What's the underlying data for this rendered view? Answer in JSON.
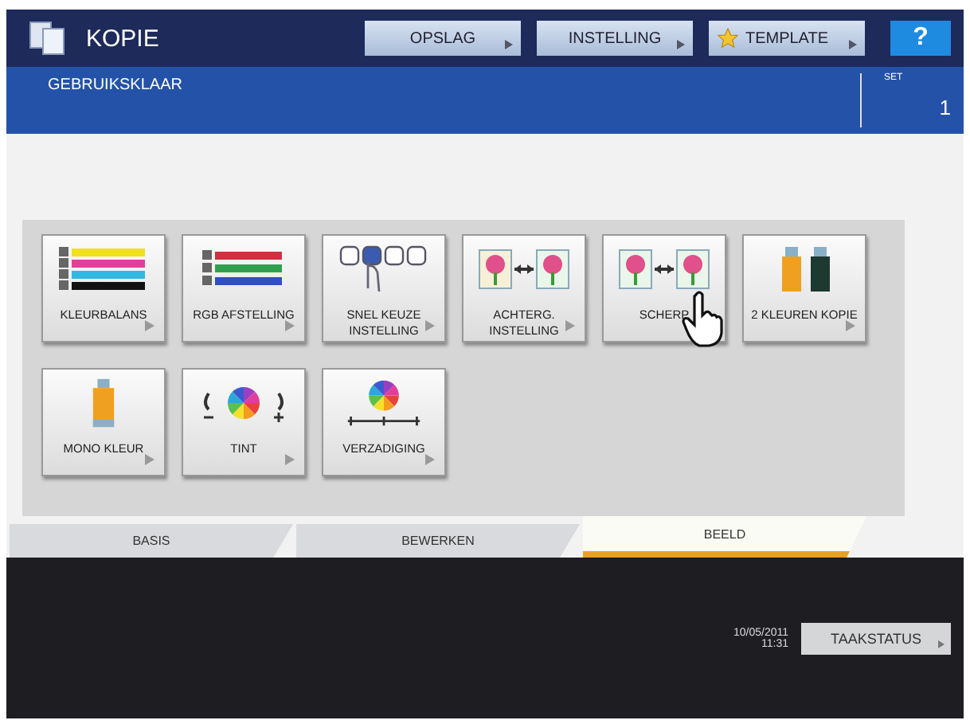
{
  "header": {
    "title": "KOPIE",
    "buttons": [
      {
        "label": "OPSLAG",
        "kind": "plain"
      },
      {
        "label": "INSTELLING",
        "kind": "plain"
      },
      {
        "label": "TEMPLATE",
        "kind": "star"
      }
    ],
    "help": "?"
  },
  "status": {
    "message": "GEBRUIKSKLAAR",
    "set_label": "SET",
    "set_value": "1"
  },
  "functions": [
    {
      "label": "KLEURBALANS",
      "kind": "cmyk"
    },
    {
      "label": "RGB AFSTELLING",
      "kind": "rgb"
    },
    {
      "label": "SNEL KEUZE INSTELLING",
      "kind": "quick"
    },
    {
      "label": "ACHTERG. INSTELLING",
      "kind": "background"
    },
    {
      "label": "SCHERP",
      "kind": "sharpness"
    },
    {
      "label": "2 KLEUREN KOPIE",
      "kind": "twocolor"
    },
    {
      "label": "MONO KLEUR",
      "kind": "mono"
    },
    {
      "label": "TINT",
      "kind": "hue"
    },
    {
      "label": "VERZADIGING",
      "kind": "saturation"
    }
  ],
  "tabs": [
    {
      "label": "BASIS",
      "selected": false
    },
    {
      "label": "BEWERKEN",
      "selected": false
    },
    {
      "label": "BEELD",
      "selected": true
    }
  ],
  "footer": {
    "date": "10/05/2011",
    "time": "11:31",
    "job_status": "TAAKSTATUS"
  }
}
